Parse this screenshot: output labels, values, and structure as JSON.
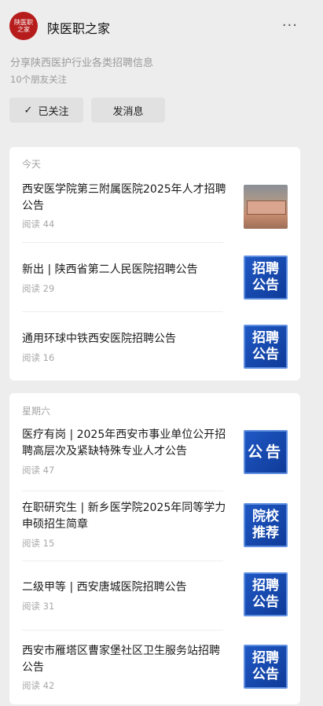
{
  "account": {
    "logo_text": [
      "陕医职",
      "之家"
    ],
    "name": "陕医职之家",
    "more_icon": "more-dots-icon",
    "description": "分享陕西医护行业各类招聘信息",
    "friends": "10个朋友关注",
    "follow_label": "已关注",
    "message_label": "发消息"
  },
  "groups": [
    {
      "day": "今天",
      "items": [
        {
          "title": "西安医学院第三附属医院2025年人才招聘公告",
          "reads": "阅读 44"
        },
        {
          "title": "新出 | 陕西省第二人民医院招聘公告",
          "reads": "阅读 29",
          "thumb": [
            "招聘",
            "公告"
          ]
        },
        {
          "title": "通用环球中铁西安医院招聘公告",
          "reads": "阅读 16",
          "thumb": [
            "招聘",
            "公告"
          ]
        }
      ]
    },
    {
      "day": "星期六",
      "items": [
        {
          "title": "医疗有岗 | 2025年西安市事业单位公开招聘高层次及紧缺特殊专业人才公告",
          "reads": "阅读 47",
          "thumb": [
            "公告"
          ]
        },
        {
          "title": "在职研究生 | 新乡医学院2025年同等学力申硕招生简章",
          "reads": "阅读 15",
          "thumb": [
            "院校",
            "推荐"
          ]
        },
        {
          "title": "二级甲等 | 西安唐城医院招聘公告",
          "reads": "阅读 31",
          "thumb": [
            "招聘",
            "公告"
          ]
        },
        {
          "title": "西安市雁塔区曹家堡社区卫生服务站招聘公告",
          "reads": "阅读 42",
          "thumb": [
            "招聘",
            "公告"
          ]
        }
      ]
    }
  ]
}
